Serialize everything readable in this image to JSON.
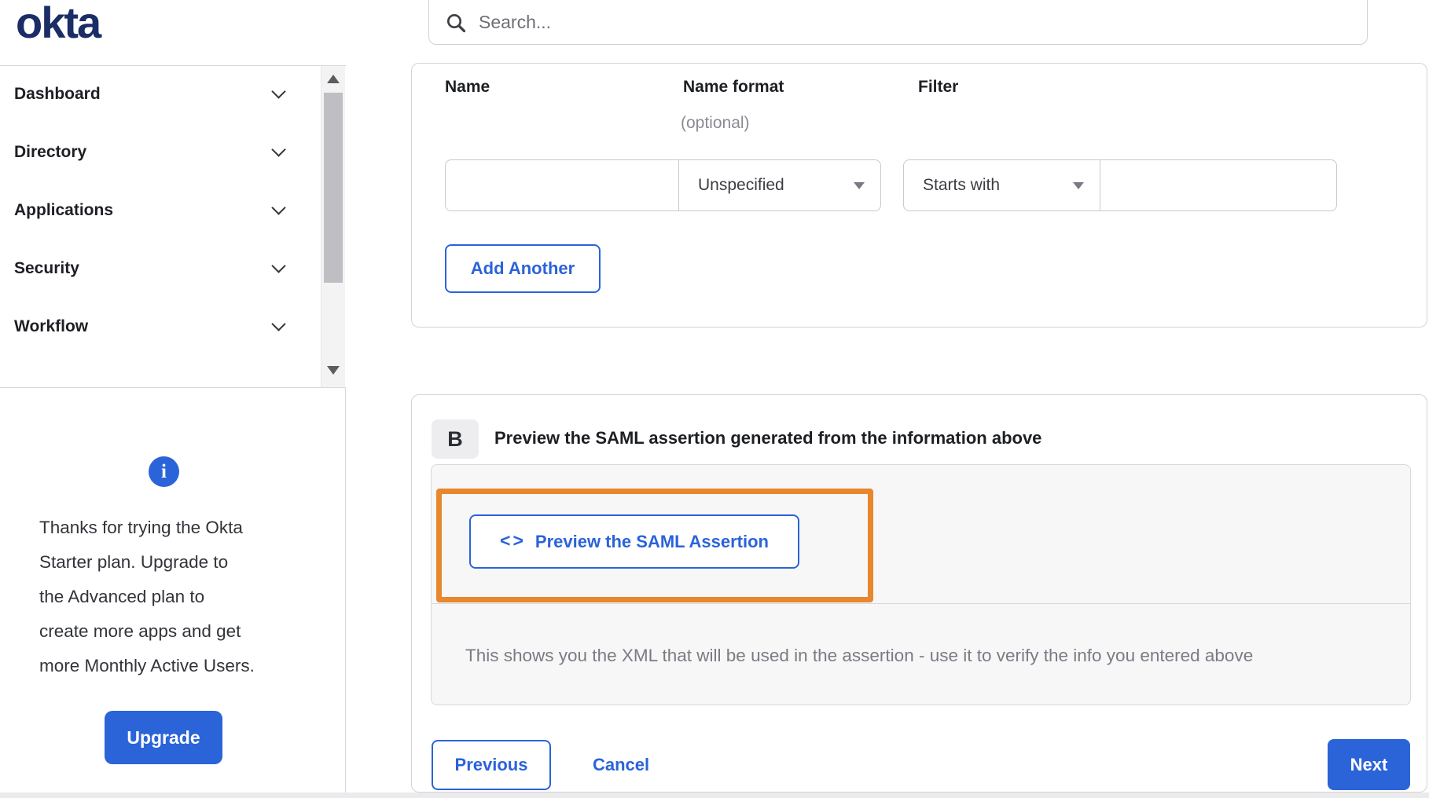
{
  "brand": {
    "logo": "okta"
  },
  "search": {
    "placeholder": "Search..."
  },
  "sidebar": {
    "items": [
      {
        "label": "Dashboard"
      },
      {
        "label": "Directory"
      },
      {
        "label": "Applications"
      },
      {
        "label": "Security"
      },
      {
        "label": "Workflow"
      }
    ]
  },
  "upgrade_panel": {
    "message_lines": [
      "Thanks for trying the Okta",
      "Starter plan. Upgrade to",
      "the Advanced plan to",
      "create more apps and get",
      "more Monthly Active Users."
    ],
    "button_label": "Upgrade"
  },
  "attribute_form": {
    "columns": [
      {
        "label": "Name",
        "sub": ""
      },
      {
        "label": "Name format",
        "sub": "(optional)"
      },
      {
        "label": "Filter",
        "sub": ""
      }
    ],
    "name_value": "",
    "name_format_value": "Unspecified",
    "filter_type_value": "Starts with",
    "filter_value": "",
    "add_another_label": "Add Another"
  },
  "preview_section": {
    "badge": "B",
    "title": "Preview the SAML assertion generated from the information above",
    "preview_button_label": "Preview the SAML Assertion",
    "description": "This shows you the XML that will be used in the assertion - use it to verify the info you entered above"
  },
  "footer": {
    "previous_label": "Previous",
    "cancel_label": "Cancel",
    "next_label": "Next"
  },
  "icons": {
    "info": "i",
    "code": "<>"
  },
  "colors": {
    "accent_blue": "#2b63d9",
    "logo_navy": "#1a2d66",
    "highlight_orange": "#e8872d",
    "panel_gray": "#f7f7f8"
  }
}
